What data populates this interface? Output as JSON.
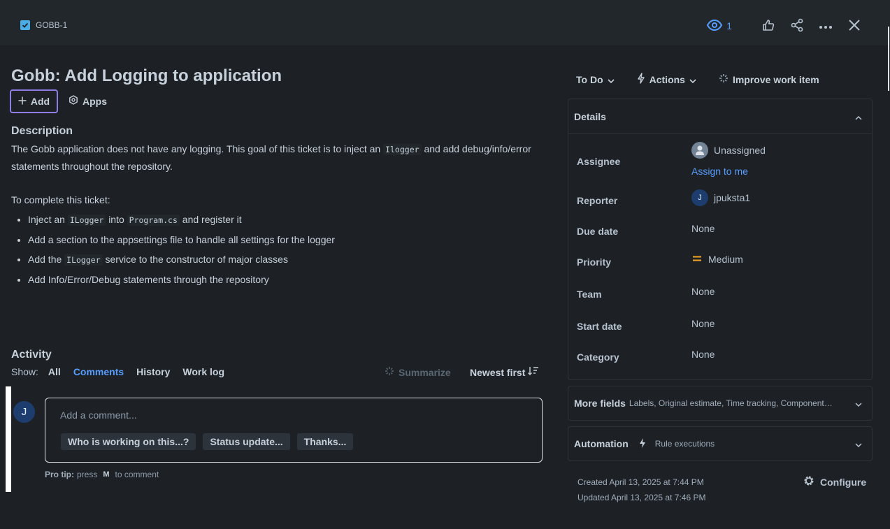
{
  "header": {
    "issue_key": "GOBB-1",
    "watch_count": "1",
    "icons": [
      "checkbox-icon",
      "eye-icon",
      "thumbs-up-icon",
      "share-icon",
      "more-icon",
      "close-icon"
    ]
  },
  "issue": {
    "title": "Gobb: Add Logging to application",
    "add_label": "Add",
    "apps_label": "Apps"
  },
  "description": {
    "heading": "Description",
    "p1_a": "The Gobb application does not have any logging. This goal of this ticket is to inject an",
    "p1_code": "Ilogger",
    "p1_b": "and add debug/info/error statements throughout the repository.",
    "p2": "To complete this ticket:",
    "b1_a": "Inject an",
    "b1_code1": "ILogger",
    "b1_b": "into",
    "b1_code2": "Program.cs",
    "b1_c": "and register it",
    "b2": "Add a section to the appsettings file to handle all settings for the logger",
    "b3_a": "Add the",
    "b3_code": "ILogger",
    "b3_b": "service to the constructor of major classes",
    "b4": "Add Info/Error/Debug statements through the repository"
  },
  "activity": {
    "heading": "Activity",
    "show_label": "Show:",
    "filters": [
      "All",
      "Comments",
      "History",
      "Work log"
    ],
    "active_filter": "Comments",
    "summarize": "Summarize",
    "sort": "Newest first",
    "avatar_initial": "J",
    "comment_placeholder": "Add a comment...",
    "chips": [
      "Who is working on this...?",
      "Status update...",
      "Thanks..."
    ],
    "protip_label": "Pro tip:",
    "protip_press": "press",
    "protip_key": "M",
    "protip_suffix": "to comment"
  },
  "sidebar": {
    "status": "To Do",
    "actions": "Actions",
    "improve": "Improve work item",
    "details_title": "Details",
    "fields": {
      "assignee_label": "Assignee",
      "assignee_value": "Unassigned",
      "assign_to_me": "Assign to me",
      "reporter_label": "Reporter",
      "reporter_initial": "J",
      "reporter_value": "jpuksta1",
      "due_label": "Due date",
      "due_value": "None",
      "priority_label": "Priority",
      "priority_value": "Medium",
      "team_label": "Team",
      "team_value": "None",
      "start_label": "Start date",
      "start_value": "None",
      "category_label": "Category",
      "category_value": "None"
    },
    "more_fields_title": "More fields",
    "more_fields_sub": "Labels, Original estimate, Time tracking, Components,...",
    "automation_title": "Automation",
    "automation_sub": "Rule executions",
    "created": "Created April 13, 2025 at 7:44 PM",
    "updated": "Updated April 13, 2025 at 7:46 PM",
    "configure": "Configure"
  },
  "colors": {
    "background": "#1d2125",
    "accent_blue": "#579dff",
    "focus_purple": "#8f7ee7",
    "priority_medium": "#f5a623",
    "checkbox_blue": "#4bade8"
  }
}
